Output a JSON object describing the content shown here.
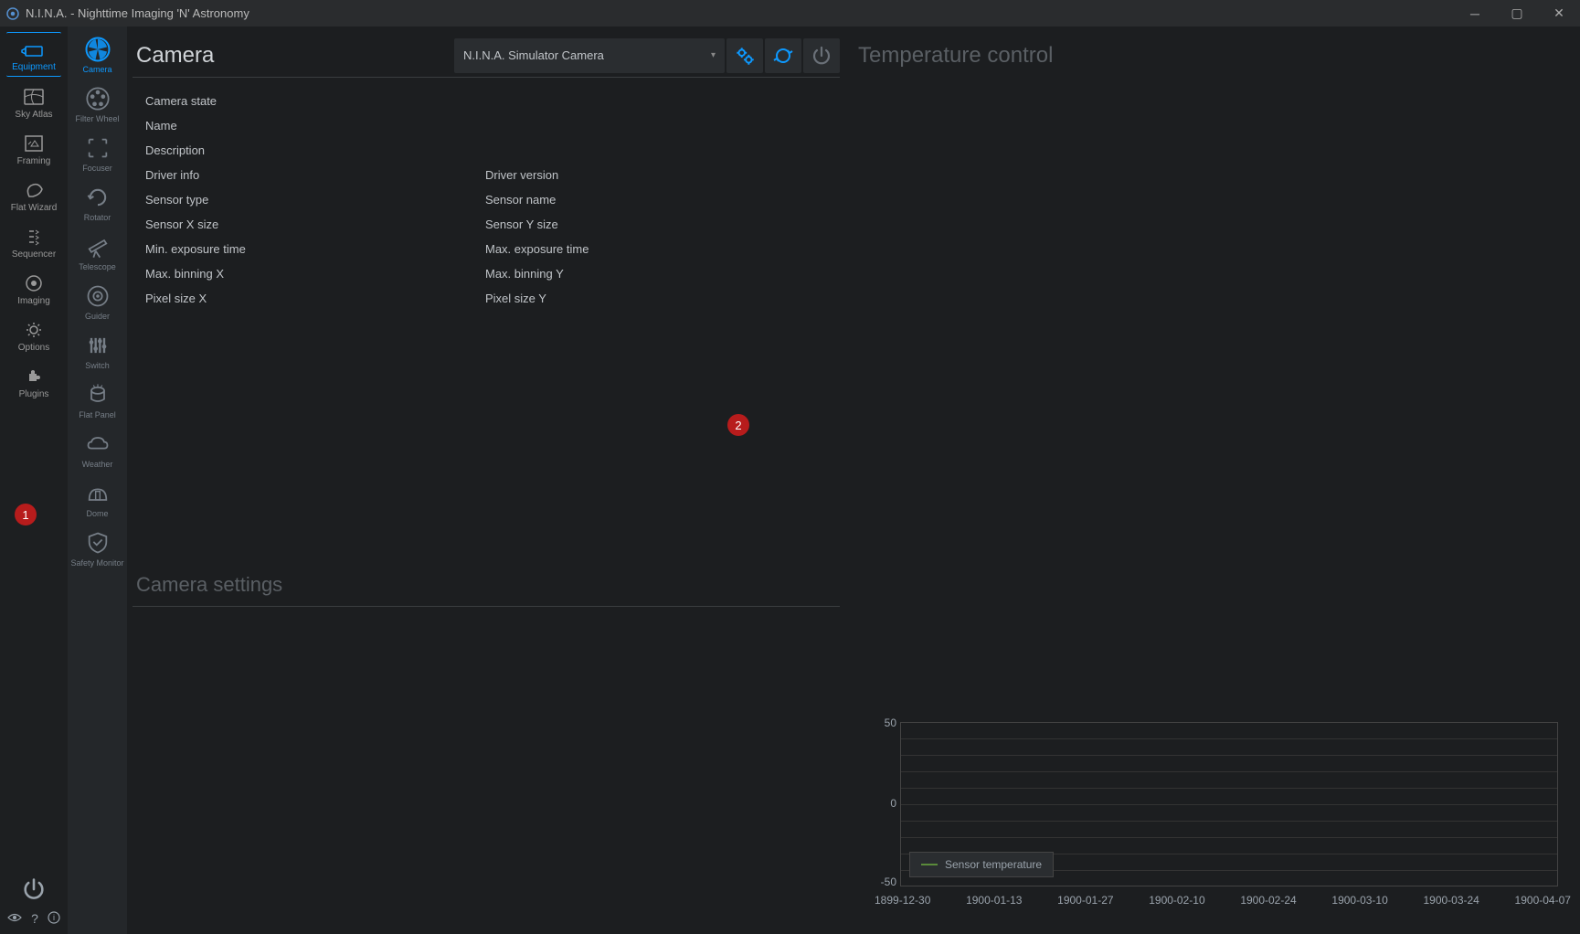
{
  "window": {
    "title": "N.I.N.A. - Nighttime Imaging 'N' Astronomy"
  },
  "sidebar": {
    "items": [
      {
        "label": "Equipment"
      },
      {
        "label": "Sky Atlas"
      },
      {
        "label": "Framing"
      },
      {
        "label": "Flat Wizard"
      },
      {
        "label": "Sequencer"
      },
      {
        "label": "Imaging"
      },
      {
        "label": "Options"
      },
      {
        "label": "Plugins"
      }
    ],
    "badge1": "1"
  },
  "equipment": {
    "items": [
      {
        "label": "Camera"
      },
      {
        "label": "Filter Wheel"
      },
      {
        "label": "Focuser"
      },
      {
        "label": "Rotator"
      },
      {
        "label": "Telescope"
      },
      {
        "label": "Guider"
      },
      {
        "label": "Switch"
      },
      {
        "label": "Flat Panel"
      },
      {
        "label": "Weather"
      },
      {
        "label": "Dome"
      },
      {
        "label": "Safety Monitor"
      }
    ]
  },
  "camera": {
    "title": "Camera",
    "selected": "N.I.N.A. Simulator Camera",
    "labels": {
      "camera_state": "Camera state",
      "name": "Name",
      "description": "Description",
      "driver_info": "Driver info",
      "driver_version": "Driver version",
      "sensor_type": "Sensor type",
      "sensor_name": "Sensor name",
      "sensor_x": "Sensor X size",
      "sensor_y": "Sensor Y size",
      "min_exp": "Min. exposure time",
      "max_exp": "Max. exposure time",
      "max_bin_x": "Max. binning X",
      "max_bin_y": "Max. binning Y",
      "pixel_x": "Pixel size X",
      "pixel_y": "Pixel size Y"
    },
    "badge2": "2",
    "settings_title": "Camera settings"
  },
  "temperature": {
    "title": "Temperature control",
    "legend": "Sensor temperature"
  },
  "chart_data": {
    "type": "line",
    "series": [
      {
        "name": "Sensor temperature",
        "values": []
      }
    ],
    "x_ticks": [
      "1899-12-30",
      "1900-01-13",
      "1900-01-27",
      "1900-02-10",
      "1900-02-24",
      "1900-03-10",
      "1900-03-24",
      "1900-04-07"
    ],
    "y_ticks": [
      "50",
      "0",
      "-50"
    ],
    "ylim": [
      -50,
      50
    ]
  }
}
